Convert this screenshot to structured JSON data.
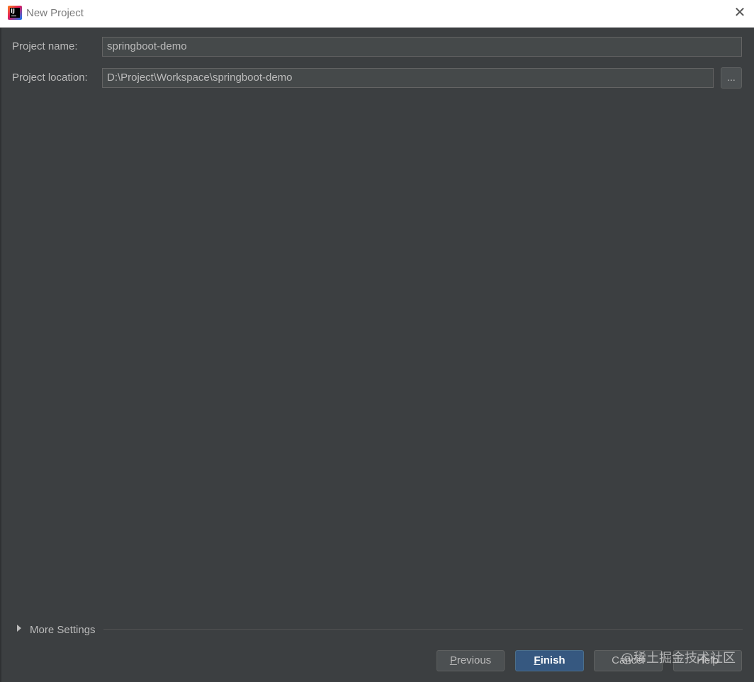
{
  "window": {
    "title": "New Project"
  },
  "form": {
    "name_label": "Project name:",
    "name_value": "springboot-demo",
    "location_label": "Project location:",
    "location_value": "D:\\Project\\Workspace\\springboot-demo",
    "browse_label": "..."
  },
  "more_settings": {
    "label": "More Settings"
  },
  "buttons": {
    "previous": {
      "mnemonic": "P",
      "rest": "revious"
    },
    "finish": {
      "mnemonic": "F",
      "rest": "inish"
    },
    "cancel": "Cancel",
    "help": "Help"
  },
  "watermark": "@稀土掘金技术社区",
  "colors": {
    "dialog_bg": "#3c3f41",
    "primary_button": "#365880",
    "field_bg": "#45494a"
  },
  "icons": {
    "app": "intellij-idea-icon",
    "close": "close-icon",
    "expand": "triangle-right-icon"
  }
}
